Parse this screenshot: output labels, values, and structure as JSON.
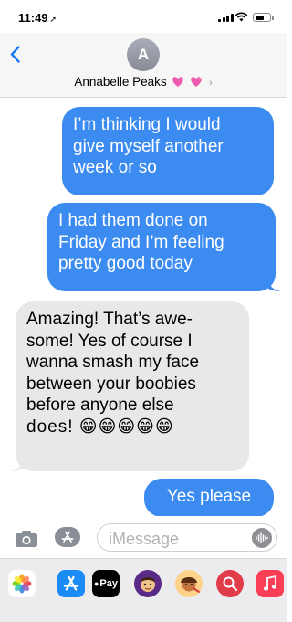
{
  "status": {
    "time": "11:49"
  },
  "header": {
    "avatar_initial": "A",
    "contact_name": "Annabelle Peaks"
  },
  "messages": [
    {
      "from": "me",
      "lines": [
        "I’m thinking I would",
        "give myself another",
        "week or so"
      ]
    },
    {
      "from": "me",
      "lines": [
        "I had them done on",
        "Friday and I’m feeling",
        "pretty good today"
      ]
    },
    {
      "from": "them",
      "lines": [
        "Amazing! That’s awe-",
        "some! Yes of course I",
        "wanna smash my face",
        "between your boobies",
        "before anyone else",
        "does! 😁😁😁😁😁"
      ]
    },
    {
      "from": "me",
      "lines": [
        "Yes please"
      ]
    }
  ],
  "input": {
    "placeholder": "iMessage"
  },
  "tray": {
    "apple_pay_label": "Pay"
  },
  "colors": {
    "outgoing": "#3c8bf0",
    "incoming": "#e8e8ea",
    "accent": "#1a7cf5"
  }
}
